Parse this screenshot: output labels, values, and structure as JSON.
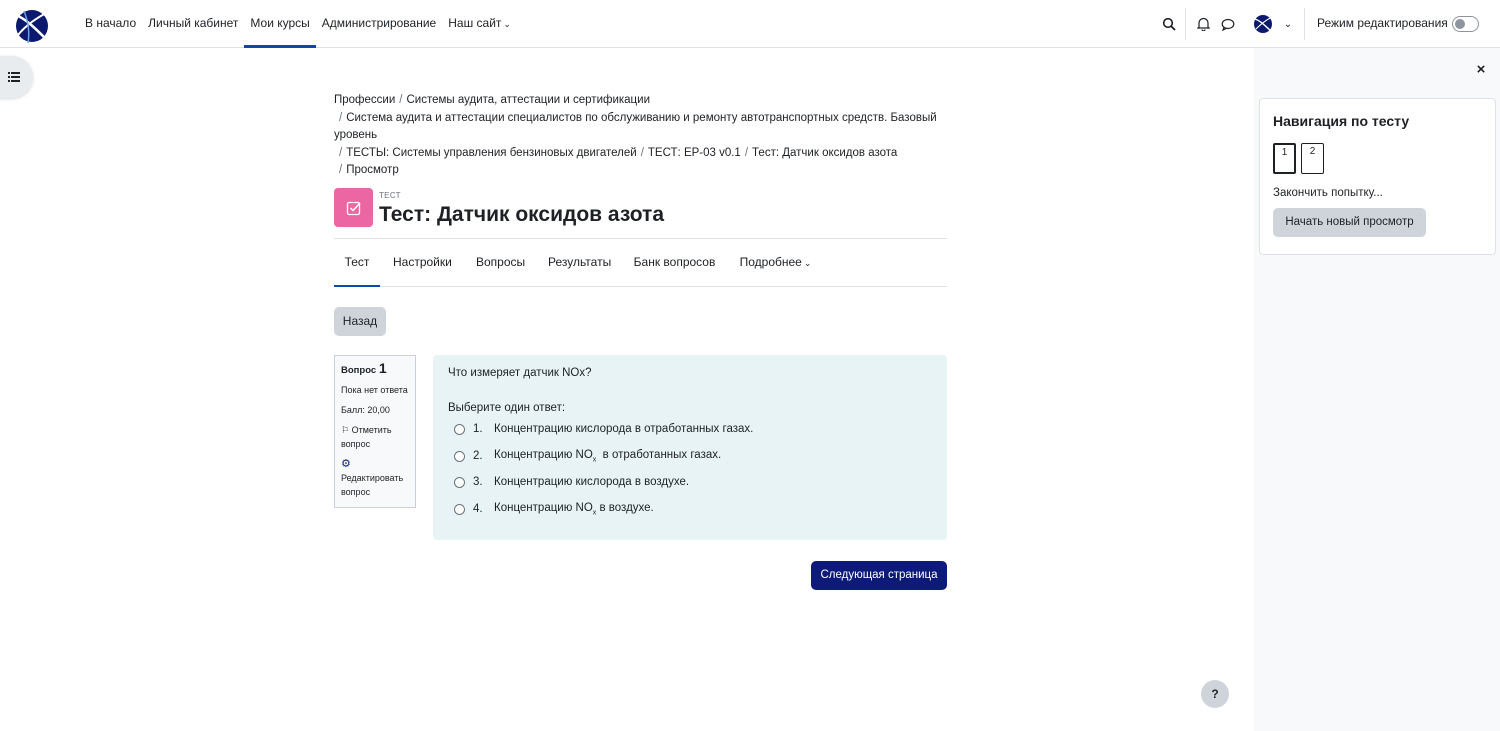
{
  "navbar": {
    "items": [
      {
        "label": "В начало"
      },
      {
        "label": "Личный кабинет"
      },
      {
        "label": "Мои курсы"
      },
      {
        "label": "Администрирование"
      },
      {
        "label": "Наш сайт"
      }
    ],
    "edit_mode_label": "Режим редактирования"
  },
  "breadcrumb": {
    "items": [
      "Профессии",
      "Системы аудита, аттестации и сертификации",
      "Система аудита и аттестации специалистов по обслуживанию и ремонту автотранспортных средств. Базовый",
      "уровень",
      "ТЕСТЫ: Системы управления бензиновых двигателей",
      "ТЕСТ: EP-03 v0.1",
      "Тест: Датчик оксидов азота",
      "Просмотр"
    ],
    "separator": "/"
  },
  "header": {
    "activity_type": "ТЕСТ",
    "title": "Тест: Датчик оксидов азота"
  },
  "tabs": [
    {
      "label": "Тест"
    },
    {
      "label": "Настройки"
    },
    {
      "label": "Вопросы"
    },
    {
      "label": "Результаты"
    },
    {
      "label": "Банк вопросов"
    },
    {
      "label": "Подробнее"
    }
  ],
  "back_label": "Назад",
  "question_info": {
    "label": "Вопрос",
    "number": "1",
    "status": "Пока нет ответа",
    "grade": "Балл: 20,00",
    "flag_label": "Отметить вопрос",
    "edit_label": "Редактировать вопрос"
  },
  "question": {
    "text": "Что измеряет датчик NOx?",
    "prompt": "Выберите один ответ:",
    "answers": [
      {
        "num": "1.",
        "text": "Концентрацию кислорода в отработанных газах."
      },
      {
        "num": "2.",
        "text_before": "Концентрацию NO",
        "sub": "x",
        "text_after": "  в отработанных газах."
      },
      {
        "num": "3.",
        "text": "Концентрацию кислорода в воздухе."
      },
      {
        "num": "4.",
        "text_before": "Концентрацию NO",
        "sub": "x",
        "text_after": " в воздухе."
      }
    ]
  },
  "next_label": "Следующая страница",
  "quiz_nav": {
    "title": "Навигация по тесту",
    "questions": [
      "1",
      "2"
    ],
    "finish_label": "Закончить попытку...",
    "new_preview_label": "Начать новый просмотр"
  },
  "help_label": "?",
  "colors": {
    "primary": "#0f47ad",
    "next_button": "#0d1a7a",
    "quiz_icon": "#eb66a2",
    "question_bg": "#e7f3f5"
  }
}
